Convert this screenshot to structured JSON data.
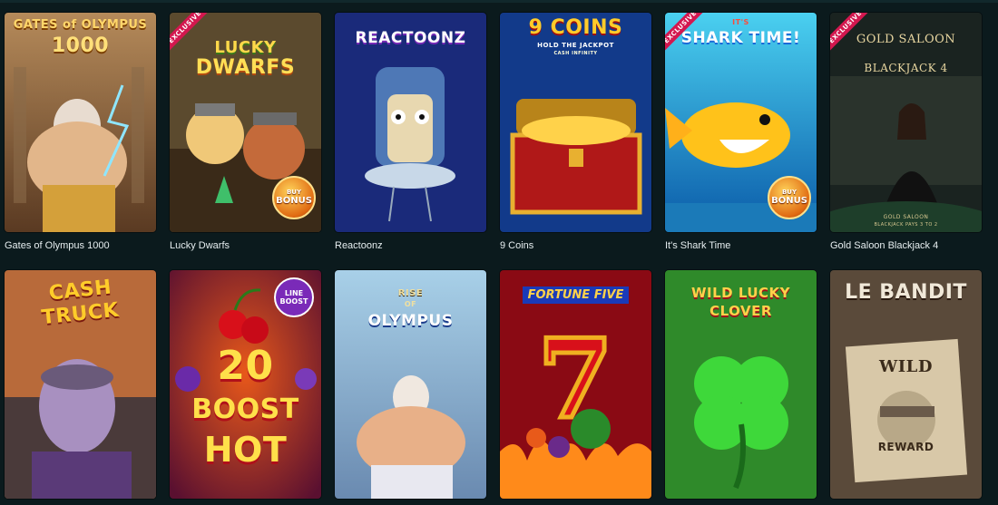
{
  "games": [
    {
      "id": "gates",
      "caption": "Gates of Olympus 1000",
      "logo_line1": "GATES of OLYMPUS",
      "logo_line2": "1000",
      "exclusive": false,
      "buy_bonus": false
    },
    {
      "id": "dwarfs",
      "caption": "Lucky Dwarfs",
      "logo_line1": "LUCKY",
      "logo_line2": "DWARFS",
      "exclusive": true,
      "buy_bonus": true
    },
    {
      "id": "reactoonz",
      "caption": "Reactoonz",
      "logo_line1": "REACTOONZ",
      "exclusive": false,
      "buy_bonus": false
    },
    {
      "id": "coins",
      "caption": "9 Coins",
      "logo_line1": "9 COINS",
      "logo_line2": "HOLD THE JACKPOT",
      "logo_line3": "CASH INFINITY",
      "exclusive": false,
      "buy_bonus": false
    },
    {
      "id": "shark",
      "caption": "It's Shark Time",
      "logo_line1": "IT'S",
      "logo_line2": "SHARK TIME!",
      "exclusive": true,
      "buy_bonus": true
    },
    {
      "id": "saloon",
      "caption": "Gold Saloon Blackjack 4",
      "logo_line1": "GOLD SALOON",
      "logo_line2": "BLACKJACK 4",
      "table_text": "GOLD SALOON",
      "table_sub": "BLACKJACK PAYS 3 TO 2",
      "exclusive": true,
      "buy_bonus": false
    },
    {
      "id": "cashtruck",
      "logo_line1": "CASH",
      "logo_line2": "TRUCK",
      "exclusive": false,
      "buy_bonus": false
    },
    {
      "id": "boosthot",
      "logo_line1": "20",
      "logo_line2": "BOOST",
      "logo_line3": "HOT",
      "line_boost": "LINE BOOST",
      "exclusive": false,
      "buy_bonus": false
    },
    {
      "id": "riseolympus",
      "logo_line1": "RISE",
      "logo_line2": "OF",
      "logo_line3": "OLYMPUS",
      "exclusive": false,
      "buy_bonus": false
    },
    {
      "id": "fortune",
      "logo_line1": "FORTUNE FIVE",
      "seven": "7",
      "exclusive": false,
      "buy_bonus": false
    },
    {
      "id": "clover",
      "logo_line1": "WILD LUCKY",
      "logo_line2": "CLOVER",
      "exclusive": false,
      "buy_bonus": false
    },
    {
      "id": "bandit",
      "logo_line1": "LE BANDIT",
      "poster_top": "WILD",
      "poster_bottom": "REWARD",
      "exclusive": false,
      "buy_bonus": false
    }
  ],
  "badges": {
    "exclusive": "EXCLUSIVE",
    "buy": "BUY",
    "bonus": "BONUS"
  }
}
